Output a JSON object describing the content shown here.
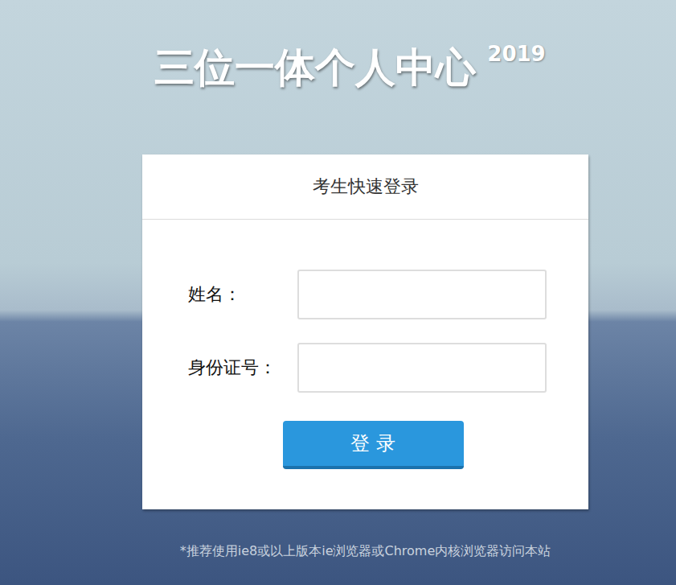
{
  "page": {
    "title": "三位一体个人中心",
    "year": "2019"
  },
  "login": {
    "heading": "考生快速登录",
    "fields": [
      {
        "label": "姓名：",
        "value": ""
      },
      {
        "label": "身份证号：",
        "value": ""
      }
    ],
    "button": "登 录"
  },
  "footer": "*推荐使用ie8或以上版本ie浏览器或Chrome内核浏览器访问本站"
}
